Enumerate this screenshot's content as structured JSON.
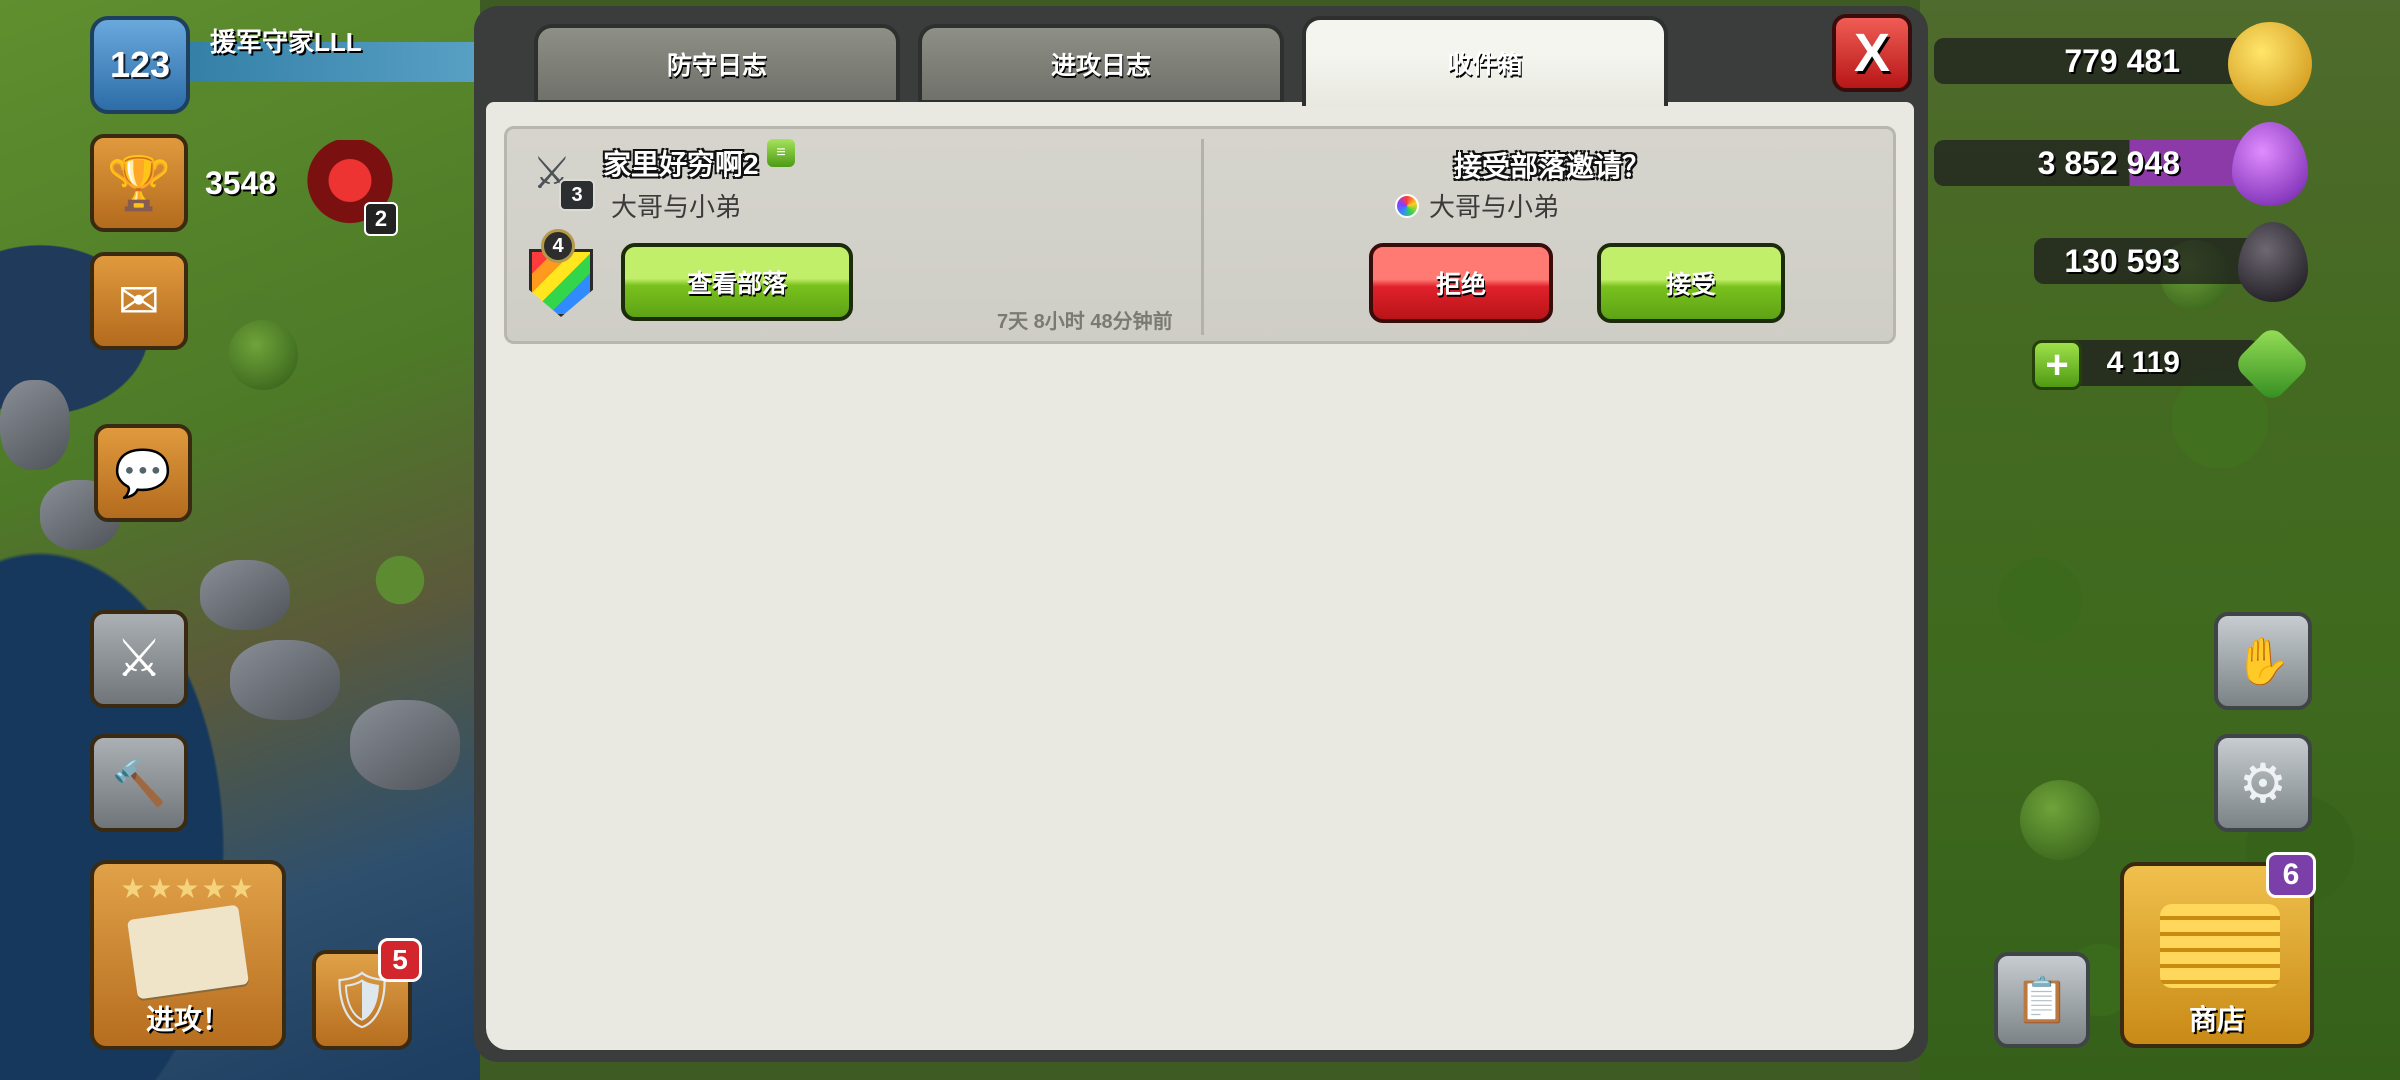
{
  "hud": {
    "player_level": "123",
    "player_name": "援军守家LLL",
    "trophies": "3548",
    "league_rank": "2",
    "attack_label": "进攻！",
    "attack_stars": "★★★★★",
    "shield_badge": "5",
    "shop_label": "商店",
    "shop_badge": "6"
  },
  "resources": {
    "gold": "779 481",
    "elixir": "3 852 948",
    "dark_elixir": "130 593",
    "gems": "4 119"
  },
  "tabs": [
    {
      "label": "防守日志",
      "active": false
    },
    {
      "label": "进攻日志",
      "active": false
    },
    {
      "label": "收件箱",
      "active": true
    }
  ],
  "close_label": "X",
  "message": {
    "town_hall_level": "3",
    "sender": "家里好穷啊2",
    "sender_clan": "大哥与小弟",
    "clan_level": "4",
    "view_clan_label": "查看部落",
    "time_ago": "7天 8小时 48分钟前",
    "invite_title": "接受部落邀请？",
    "invite_clan": "大哥与小弟",
    "reject_label": "拒绝",
    "accept_label": "接受"
  }
}
